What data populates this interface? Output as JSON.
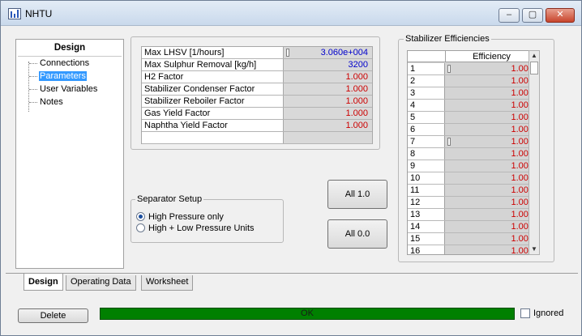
{
  "window": {
    "title": "NHTU",
    "minimize_glyph": "–",
    "maximize_glyph": "▢",
    "close_glyph": "✕"
  },
  "nav": {
    "title": "Design",
    "items": [
      {
        "label": "Connections",
        "selected": false
      },
      {
        "label": "Parameters",
        "selected": true
      },
      {
        "label": "User Variables",
        "selected": false
      },
      {
        "label": "Notes",
        "selected": false
      }
    ]
  },
  "parameters": {
    "rows": [
      {
        "name": "Max LHSV [1/hours]",
        "value": "3.060e+004",
        "color": "blue"
      },
      {
        "name": "Max Sulphur Removal [kg/h]",
        "value": "3200",
        "color": "blue"
      },
      {
        "name": "H2 Factor",
        "value": "1.000",
        "color": "red"
      },
      {
        "name": "Stabilizer Condenser Factor",
        "value": "1.000",
        "color": "red"
      },
      {
        "name": "Stabilizer Reboiler Factor",
        "value": "1.000",
        "color": "red"
      },
      {
        "name": "Gas Yield Factor",
        "value": "1.000",
        "color": "red"
      },
      {
        "name": "Naphtha Yield Factor",
        "value": "1.000",
        "color": "red"
      },
      {
        "name": "",
        "value": "",
        "color": "red"
      }
    ]
  },
  "separator": {
    "legend": "Separator Setup",
    "options": [
      {
        "label": "High Pressure only",
        "selected": true
      },
      {
        "label": "High + Low Pressure Units",
        "selected": false
      }
    ]
  },
  "buttons": {
    "all_one": "All 1.0",
    "all_zero": "All 0.0",
    "delete": "Delete"
  },
  "efficiencies": {
    "legend": "Stabilizer Efficiencies",
    "column_header": "Efficiency",
    "rows": [
      {
        "idx": "1",
        "value": "1.000"
      },
      {
        "idx": "2",
        "value": "1.000"
      },
      {
        "idx": "3",
        "value": "1.000"
      },
      {
        "idx": "4",
        "value": "1.000"
      },
      {
        "idx": "5",
        "value": "1.000"
      },
      {
        "idx": "6",
        "value": "1.000"
      },
      {
        "idx": "7",
        "value": "1.000"
      },
      {
        "idx": "8",
        "value": "1.000"
      },
      {
        "idx": "9",
        "value": "1.000"
      },
      {
        "idx": "10",
        "value": "1.000"
      },
      {
        "idx": "11",
        "value": "1.000"
      },
      {
        "idx": "12",
        "value": "1.000"
      },
      {
        "idx": "13",
        "value": "1.000"
      },
      {
        "idx": "14",
        "value": "1.000"
      },
      {
        "idx": "15",
        "value": "1.000"
      },
      {
        "idx": "16",
        "value": "1.000"
      }
    ]
  },
  "tabs": [
    {
      "label": "Design",
      "active": true
    },
    {
      "label": "Operating Data",
      "active": false
    },
    {
      "label": "Worksheet",
      "active": false
    }
  ],
  "status": {
    "text": "OK",
    "color": "#008000"
  },
  "ignored": {
    "label": "Ignored",
    "checked": false
  },
  "colors": {
    "value_red": "#cc0000",
    "value_blue": "#0000cc",
    "selection": "#3399ff"
  }
}
